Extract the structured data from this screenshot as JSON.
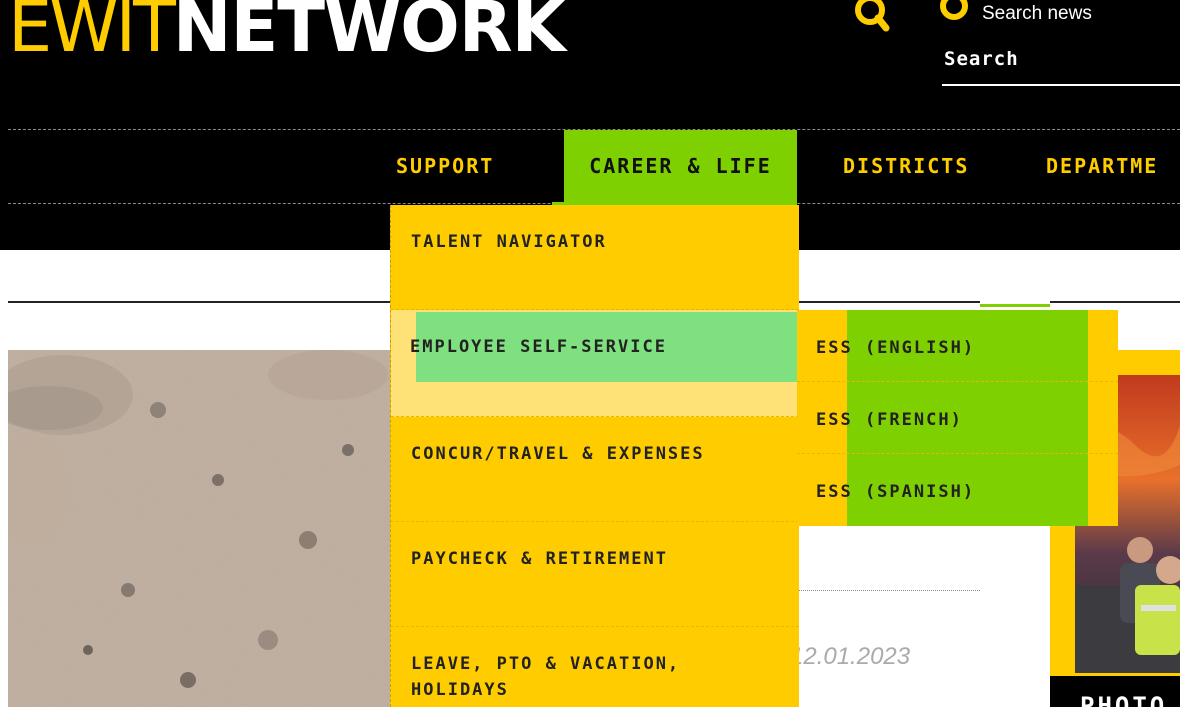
{
  "header": {
    "logo_thin": "EWIT",
    "logo_bold": "NETWORK",
    "search_news_label": "Search news",
    "search_label": "Search"
  },
  "nav": {
    "items": [
      {
        "label": "SUPPORT"
      },
      {
        "label": "CAREER & LIFE",
        "active": true
      },
      {
        "label": "DISTRICTS"
      },
      {
        "label": "DEPARTME"
      }
    ]
  },
  "dropdown": {
    "items": [
      {
        "label": "TALENT NAVIGATOR"
      },
      {
        "label": "EMPLOYEE SELF-SERVICE",
        "hovered": true
      },
      {
        "label": "CONCUR/TRAVEL & EXPENSES"
      },
      {
        "label": "PAYCHECK & RETIREMENT"
      },
      {
        "label": "LEAVE, PTO & VACATION, HOLIDAYS"
      }
    ]
  },
  "submenu": {
    "items": [
      {
        "label": "ESS (ENGLISH)"
      },
      {
        "label": "ESS (FRENCH)"
      },
      {
        "label": "ESS (SPANISH)"
      }
    ]
  },
  "content": {
    "date": "12.01.2023",
    "card_caption": "PHOTO"
  },
  "colors": {
    "brand_yellow": "#ffcc00",
    "accent_green": "#7ed000",
    "highlight_green": "#7ee07e",
    "header_black": "#000000"
  }
}
